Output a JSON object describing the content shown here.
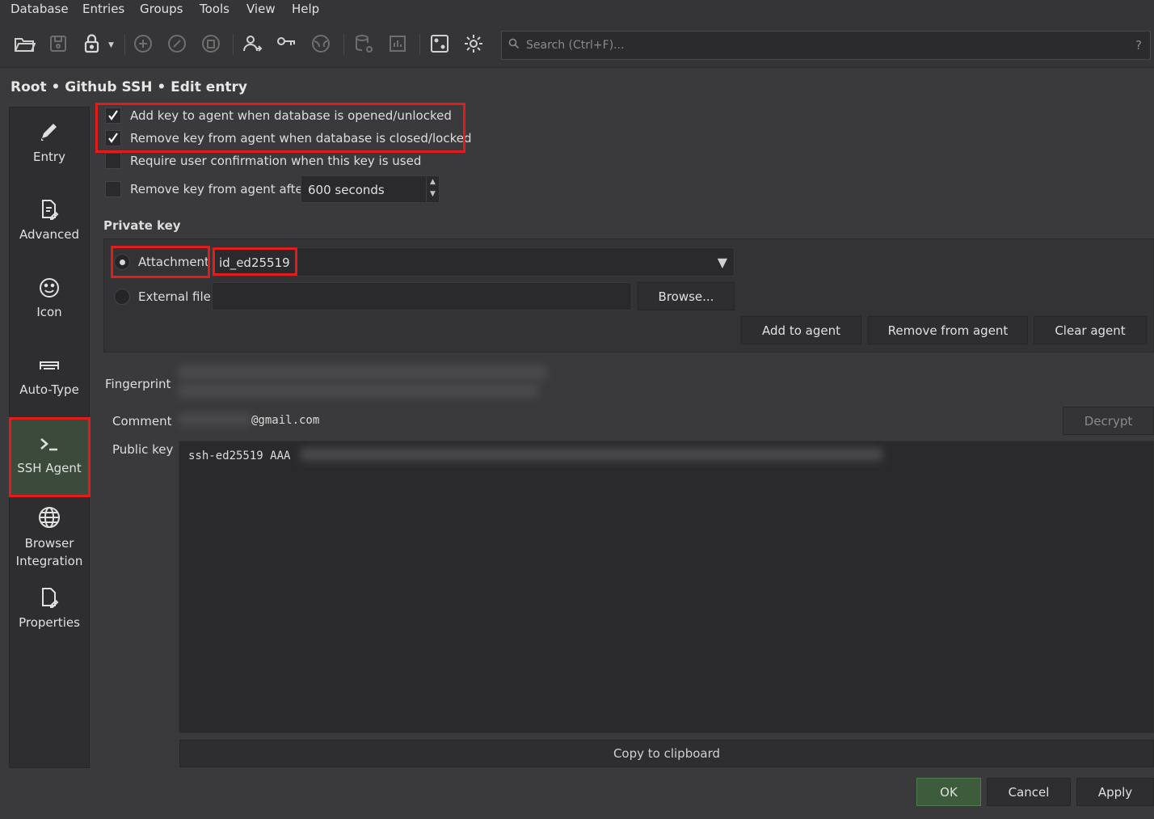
{
  "menubar": {
    "items": [
      "Database",
      "Entries",
      "Groups",
      "Tools",
      "View",
      "Help"
    ]
  },
  "toolbar": {
    "icons": [
      "open-folder-icon",
      "save-icon",
      "lock-icon",
      "add-entry-icon",
      "edit-entry-icon",
      "delete-entry-icon",
      "copy-username-icon",
      "copy-password-icon",
      "open-url-icon",
      "database-settings-icon",
      "reports-icon",
      "password-generator-icon",
      "settings-icon"
    ],
    "search_placeholder": "Search (Ctrl+F)...",
    "search_help": "?"
  },
  "breadcrumb": "Root • Github SSH • Edit entry",
  "sidebar": {
    "items": [
      {
        "label": "Entry",
        "icon": "pencil-icon"
      },
      {
        "label": "Advanced",
        "icon": "document-edit-icon"
      },
      {
        "label": "Icon",
        "icon": "smiley-icon"
      },
      {
        "label": "Auto-Type",
        "icon": "keyboard-icon"
      },
      {
        "label": "SSH Agent",
        "icon": "terminal-icon"
      },
      {
        "label": "Browser Integration",
        "icon": "globe-icon"
      },
      {
        "label": "Properties",
        "icon": "document-icon"
      }
    ],
    "active": "SSH Agent"
  },
  "options": {
    "add_on_open": {
      "label": "Add key to agent when database is opened/unlocked",
      "checked": true
    },
    "remove_on_close": {
      "label": "Remove key from agent when database is closed/locked",
      "checked": true
    },
    "require_confirm": {
      "label": "Require user confirmation when this key is used",
      "checked": false
    },
    "remove_after": {
      "label": "Remove key from agent after",
      "checked": false,
      "value": "600 seconds"
    }
  },
  "private_key": {
    "title": "Private key",
    "attachment_label": "Attachment",
    "attachment_value": "id_ed25519",
    "attachment_selected": true,
    "external_label": "External file",
    "external_value": "",
    "browse_button": "Browse...",
    "add_to_agent": "Add to agent",
    "remove_from_agent": "Remove from agent",
    "clear_agent": "Clear agent"
  },
  "details": {
    "fingerprint_label": "Fingerprint",
    "comment_label": "Comment",
    "comment_value": "@gmail.com",
    "decrypt_button": "Decrypt",
    "public_key_label": "Public key",
    "public_key_value": "ssh-ed25519 AAA",
    "copy_button": "Copy to clipboard"
  },
  "footer": {
    "ok": "OK",
    "cancel": "Cancel",
    "apply": "Apply"
  },
  "colors": {
    "highlight": "#e21b1b",
    "ok_button": "#3c5c3c",
    "background": "#3a3a3c"
  }
}
